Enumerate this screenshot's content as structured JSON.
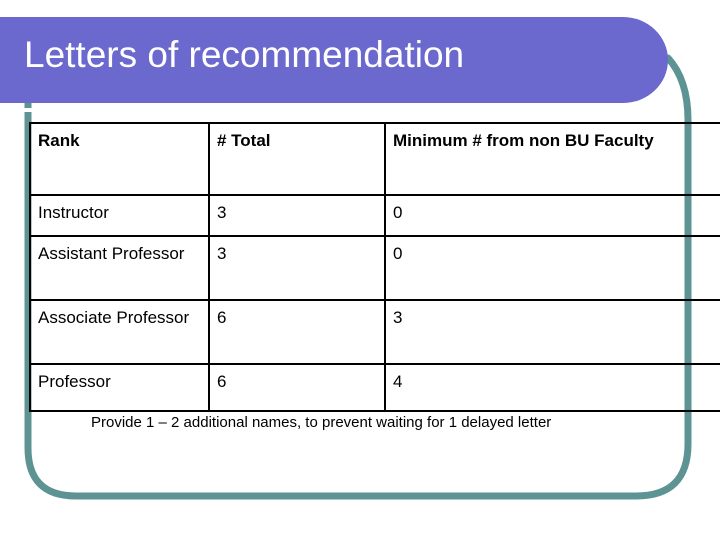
{
  "slide": {
    "title": "Letters of recommendation",
    "accent_purple": "#6B68CE",
    "accent_teal": "#5E9393",
    "background": "#ffffff"
  },
  "table": {
    "columns": [
      "Rank",
      "# Total",
      "Minimum # from non BU Faculty"
    ],
    "rows": [
      {
        "rank": "Instructor",
        "total": "3",
        "min_non_bu": "0"
      },
      {
        "rank": "Assistant Professor",
        "total": "3",
        "min_non_bu": "0"
      },
      {
        "rank": "Associate Professor",
        "total": "6",
        "min_non_bu": "3"
      },
      {
        "rank": "Professor",
        "total": "6",
        "min_non_bu": "4"
      }
    ]
  },
  "caption": {
    "text": "Provide 1 – 2 additional names, to prevent waiting for 1 delayed letter"
  }
}
